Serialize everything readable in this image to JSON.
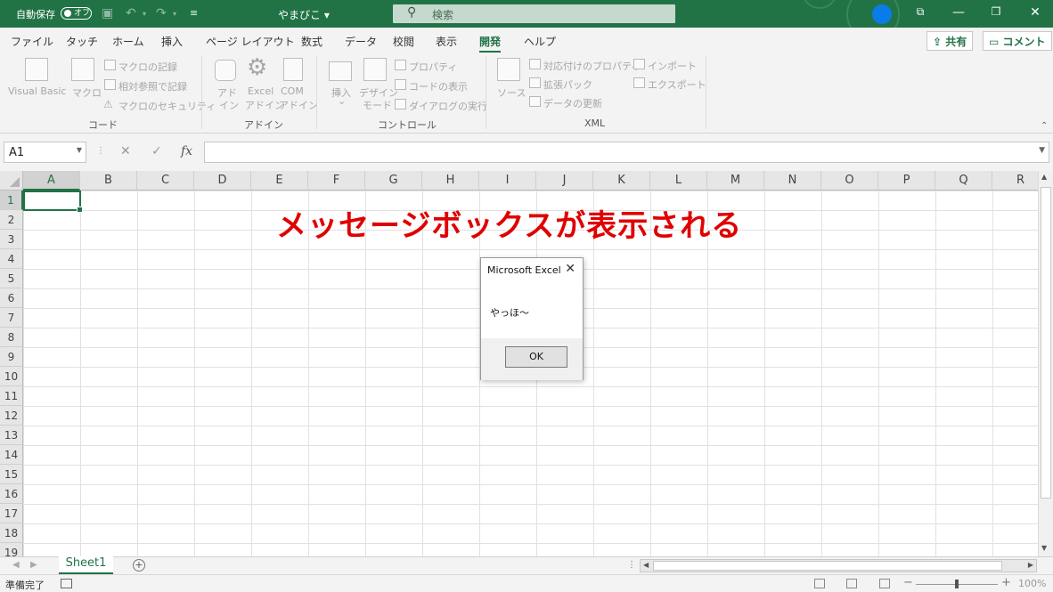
{
  "titlebar": {
    "autosave_label": "自動保存",
    "autosave_state": "オフ",
    "filename": "やまびこ ▾",
    "search_placeholder": "検索",
    "accent": "#217346"
  },
  "tabs": [
    "ファイル",
    "タッチ",
    "ホーム",
    "挿入",
    "ページ レイアウト",
    "数式",
    "データ",
    "校閲",
    "表示",
    "開発",
    "ヘルプ"
  ],
  "active_tab": "開発",
  "share_label": "共有",
  "comment_label": "コメント",
  "ribbon": {
    "code": {
      "group_label": "コード",
      "visual_basic": "Visual Basic",
      "macro": "マクロ",
      "record_macro": "マクロの記録",
      "relative_ref": "相対参照で記録",
      "macro_security": "マクロのセキュリティ"
    },
    "addins": {
      "group_label": "アドイン",
      "addin_line1": "アド",
      "addin_line2": "イン",
      "excel_addin_line1": "Excel",
      "excel_addin_line2": "アドイン",
      "com_addin_line1": "COM",
      "com_addin_line2": "アドイン"
    },
    "controls": {
      "group_label": "コントロール",
      "insert": "挿入",
      "insert_arrow": "⌄",
      "design_mode_line1": "デザイン",
      "design_mode_line2": "モード",
      "properties": "プロパティ",
      "view_code": "コードの表示",
      "run_dialog": "ダイアログの実行"
    },
    "xml": {
      "group_label": "XML",
      "source": "ソース",
      "map_properties": "対応付けのプロパティ",
      "expansion_packs": "拡張パック",
      "refresh_data": "データの更新",
      "import": "インポート",
      "export": "エクスポート"
    }
  },
  "formula_bar": {
    "name_box": "A1",
    "formula": ""
  },
  "columns": [
    "A",
    "B",
    "C",
    "D",
    "E",
    "F",
    "G",
    "H",
    "I",
    "J",
    "K",
    "L",
    "M",
    "N",
    "O",
    "P",
    "Q",
    "R"
  ],
  "rows": [
    "1",
    "2",
    "3",
    "4",
    "5",
    "6",
    "7",
    "8",
    "9",
    "10",
    "11",
    "12",
    "13",
    "14",
    "15",
    "16",
    "17",
    "18",
    "19"
  ],
  "annotation": "メッセージボックスが表示される",
  "annotation_color": "#e00000",
  "message_box": {
    "title": "Microsoft Excel",
    "message": "やっほ～",
    "ok_label": "OK"
  },
  "sheet_tab": "Sheet1",
  "status": {
    "ready": "準備完了",
    "zoom": "100%"
  }
}
